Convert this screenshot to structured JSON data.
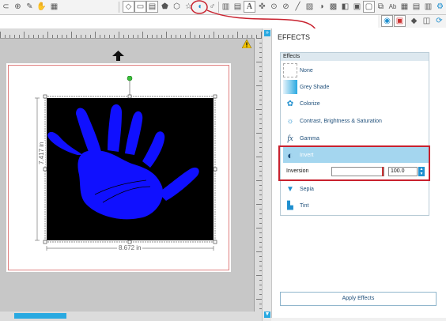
{
  "toolbar": {
    "icons": [
      "lasso-icon",
      "zoom-icon",
      "pen-icon",
      "pan-icon",
      "grid-icon",
      "eraser-icon",
      "rectangle-icon",
      "paint-icon",
      "shape-icon",
      "polygon-icon",
      "star-icon",
      "effects-icon",
      "pattern-icon",
      "fill-icon",
      "line-icon",
      "text-icon",
      "align-icon",
      "weld-icon",
      "knife-icon",
      "node-icon",
      "image-icon",
      "trace-icon",
      "library-icon",
      "send-icon",
      "store-icon",
      "settings-icon"
    ],
    "text_icon": "A",
    "ab_icon": "Ab"
  },
  "canvas": {
    "width_label": "8.672 in",
    "height_label": "7.417 in"
  },
  "panel": {
    "title": "EFFECTS",
    "group_title": "Effects",
    "items": [
      {
        "label": "None",
        "icon": "none-icon"
      },
      {
        "label": "Grey Shade",
        "icon": "grey-shade-icon"
      },
      {
        "label": "Colorize",
        "icon": "colorize-icon"
      },
      {
        "label": "Contrast, Brightness & Saturation",
        "icon": "contrast-icon"
      },
      {
        "label": "Gamma",
        "icon": "gamma-icon"
      },
      {
        "label": "Invert",
        "icon": "invert-icon"
      },
      {
        "label": "Sepia",
        "icon": "sepia-icon"
      },
      {
        "label": "Tint",
        "icon": "tint-icon"
      }
    ],
    "inversion": {
      "label": "Inversion",
      "value": "100.0",
      "fraction": 1.0
    },
    "apply_label": "Apply Effects"
  },
  "colors": {
    "accent": "#29a9e1",
    "highlight": "#c8212e",
    "hand": "#1010ff",
    "image_bg": "#000000",
    "selected": "#a4d6ef"
  }
}
